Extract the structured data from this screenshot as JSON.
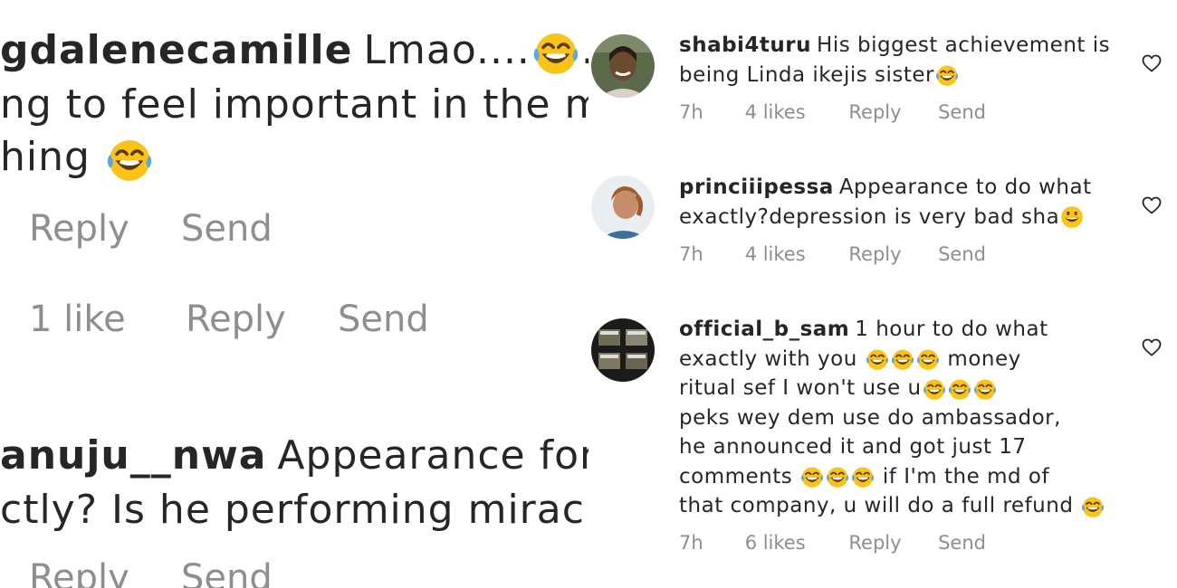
{
  "left_zoom": {
    "comment1": {
      "username": "gdalenecamille",
      "text_line1": "Lmao....",
      "text_line1_after": "... h",
      "text_line2": "ng to feel important in the mid",
      "text_line3": "hing",
      "reply_label": "Reply",
      "send_label": "Send"
    },
    "row2": {
      "likes": "1 like",
      "reply_label": "Reply",
      "send_label": "Send"
    },
    "comment2": {
      "username": "anuju__nwa",
      "text_line1": "Appearance for w",
      "text_line2": "ctly? Is he performing miracle",
      "reply_label": "Reply",
      "send_label": "Send"
    }
  },
  "comments": [
    {
      "username": "shabi4turu",
      "lines": [
        "His biggest achievement is",
        "being Linda ikejis sister"
      ],
      "time": "7h",
      "likes": "4 likes",
      "reply_label": "Reply",
      "send_label": "Send"
    },
    {
      "username": "princiiipessa",
      "lines": [
        "Appearance to do what",
        "exactly?depression is very bad sha"
      ],
      "time": "7h",
      "likes": "4 likes",
      "reply_label": "Reply",
      "send_label": "Send"
    },
    {
      "username": "official_b_sam",
      "lines": [
        "1 hour to do what",
        "exactly with you",
        "money",
        "ritual sef I won't use u",
        "peks wey dem use do ambassador,",
        "he announced it and got just 17",
        "comments",
        "if I'm the md of",
        "that company, u will do a full refund"
      ],
      "time": "7h",
      "likes": "6 likes",
      "reply_label": "Reply",
      "send_label": "Send"
    }
  ],
  "icons": {
    "heart": "heart-outline-icon",
    "laugh_emoji": "face-with-tears-of-joy-icon",
    "grin_emoji": "grinning-face-icon"
  },
  "colors": {
    "text": "#262626",
    "meta": "#8e8e8e",
    "emoji_yellow": "#f9c31a",
    "tear_blue": "#5aa7e6"
  }
}
